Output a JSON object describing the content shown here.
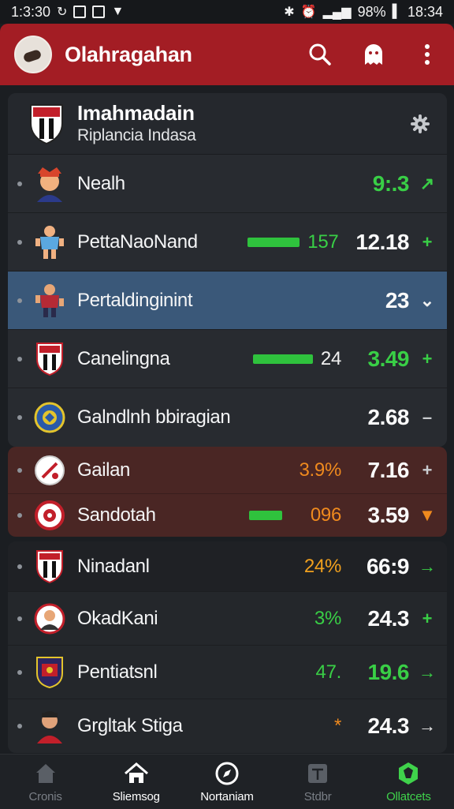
{
  "status_bar": {
    "time": "1:3:30",
    "battery": "98%",
    "clock_right": "18:34"
  },
  "app_bar": {
    "title": "Olahragahan"
  },
  "header": {
    "title": "Imahmadain",
    "subtitle": "Riplancia Indasa"
  },
  "rows": [
    {
      "name": "Nealh",
      "value": "9:.3",
      "trend": "up-right",
      "pct": "",
      "bar": 0
    },
    {
      "name": "PettaNaoNand",
      "value": "12.18",
      "trend": "plus",
      "pct": "157",
      "bar": 66
    },
    {
      "name": "Pertaldinginint",
      "value": "23",
      "trend": "chevron-down",
      "pct": "",
      "bar": 0
    },
    {
      "name": "Canelingna",
      "value": "3.49",
      "trend": "plus",
      "pct": "24",
      "bar": 76
    },
    {
      "name": "Galndlnh bbiragian",
      "value": "2.68",
      "trend": "minus",
      "pct": "",
      "bar": 0
    }
  ],
  "live_rows": [
    {
      "name": "Gailan",
      "value": "7.16",
      "trend": "plus",
      "pct": "3.9%"
    },
    {
      "name": "Sandotah",
      "value": "3.59",
      "trend": "down",
      "pct": "096",
      "bar": 42
    }
  ],
  "rows2": [
    {
      "name": "Ninadanl",
      "value": "66:9",
      "trend": "arrow-right",
      "pct": "24%"
    },
    {
      "name": "OkadKani",
      "value": "24.3",
      "trend": "plus",
      "pct": "3%"
    },
    {
      "name": "Pentiatsnl",
      "value": "19.6",
      "trend": "arrow-right",
      "pct": "47."
    },
    {
      "name": "Grgltak Stiga",
      "value": "24.3",
      "trend": "arrow-right",
      "pct": "*"
    }
  ],
  "bottom_nav": [
    {
      "label": "Cronis",
      "icon": "home-icon"
    },
    {
      "label": "Sliemsog",
      "icon": "home-icon"
    },
    {
      "label": "Nortaniam",
      "icon": "compass-icon"
    },
    {
      "label": "Stdbr",
      "icon": "table-icon"
    },
    {
      "label": "Ollatcets",
      "icon": "brand-icon"
    }
  ],
  "colors": {
    "app_bar": "#a31d24",
    "selected_row": "#3a5879",
    "live_card": "#4a2624",
    "positive": "#39cf46",
    "warning": "#ef8a1e"
  }
}
